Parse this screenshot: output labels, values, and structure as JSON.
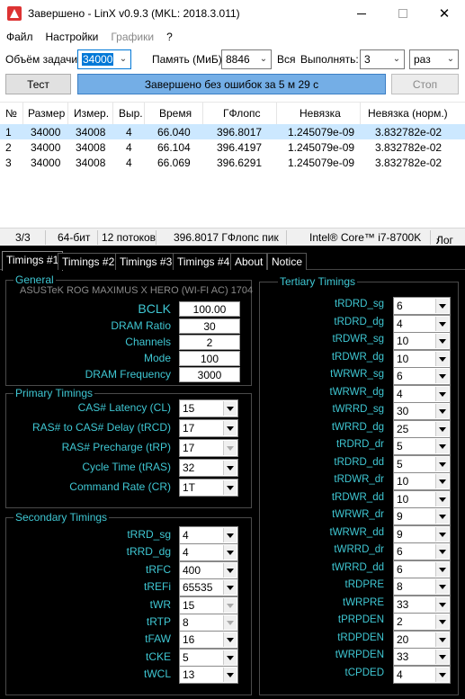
{
  "window": {
    "title": "Завершено - LinX v0.9.3 (MKL: 2018.3.011)",
    "minimize_icon": "minimize-icon",
    "maximize_icon": "maximize-icon",
    "close_icon": "close-icon",
    "close_glyph": "✕"
  },
  "menu": [
    "Файл",
    "Настройки",
    "Графики",
    "?"
  ],
  "controls": {
    "task_label": "Объём задачи:",
    "task_value": "34000",
    "memory_label": "Память (МиБ):",
    "memory_value": "8846",
    "all_label": "Вся",
    "run_label": "Выполнять:",
    "run_value": "3",
    "unit_value": "раз"
  },
  "buttons": {
    "test": "Тест",
    "progress_text": "Завершено без ошибок за 5 м 29 с",
    "progress_fraction": 1.0,
    "stop": "Стоп"
  },
  "results": {
    "headers": [
      "№",
      "Размер",
      "Измер.",
      "Выр.",
      "Время",
      "ГФлопс",
      "Невязка",
      "Невязка (норм.)"
    ],
    "rows": [
      [
        "1",
        "34000",
        "34008",
        "4",
        "66.040",
        "396.8017",
        "1.245079e-09",
        "3.832782e-02"
      ],
      [
        "2",
        "34000",
        "34008",
        "4",
        "66.104",
        "396.4197",
        "1.245079e-09",
        "3.832782e-02"
      ],
      [
        "3",
        "34000",
        "34008",
        "4",
        "66.069",
        "396.6291",
        "1.245079e-09",
        "3.832782e-02"
      ]
    ]
  },
  "status": {
    "progress": "3/3",
    "bits": "64-бит",
    "threads": "12 потоков",
    "peak": "396.8017 ГФлопс пик",
    "cpu": "Intel® Core™ i7-8700K",
    "log": "Лог",
    "log_arrow": "›"
  },
  "timing": {
    "tabs": [
      "Timings #1",
      "Timings #2",
      "Timings #3",
      "Timings #4",
      "About",
      "Notice"
    ],
    "general": {
      "title": "General",
      "motherboard": "ASUSTeK ROG MAXIMUS X HERO (WI-FI AC) 1704",
      "bclk_label": "BCLK",
      "bclk": "100.00",
      "ratio_label": "DRAM Ratio",
      "ratio": "30",
      "channels_label": "Channels",
      "channels": "2",
      "mode_label": "Mode",
      "mode": "100",
      "freq_label": "DRAM Frequency",
      "freq": "3000"
    },
    "primary": {
      "title": "Primary Timings",
      "items": [
        {
          "label": "CAS# Latency (CL)",
          "value": "15",
          "enabled": true
        },
        {
          "label": "RAS# to CAS# Delay (tRCD)",
          "value": "17",
          "enabled": true
        },
        {
          "label": "RAS# Precharge (tRP)",
          "value": "17",
          "enabled": false
        },
        {
          "label": "Cycle Time (tRAS)",
          "value": "32",
          "enabled": true
        },
        {
          "label": "Command Rate (CR)",
          "value": "1T",
          "enabled": true
        }
      ]
    },
    "secondary": {
      "title": "Secondary Timings",
      "items": [
        {
          "label": "tRRD_sg",
          "value": "4",
          "enabled": true
        },
        {
          "label": "tRRD_dg",
          "value": "4",
          "enabled": true
        },
        {
          "label": "tRFC",
          "value": "400",
          "enabled": true
        },
        {
          "label": "tREFi",
          "value": "65535",
          "enabled": true
        },
        {
          "label": "tWR",
          "value": "15",
          "enabled": false
        },
        {
          "label": "tRTP",
          "value": "8",
          "enabled": false
        },
        {
          "label": "tFAW",
          "value": "16",
          "enabled": true
        },
        {
          "label": "tCKE",
          "value": "5",
          "enabled": true
        },
        {
          "label": "tWCL",
          "value": "13",
          "enabled": true
        }
      ]
    },
    "tertiary": {
      "title": "Tertiary Timings",
      "items": [
        {
          "label": "tRDRD_sg",
          "value": "6"
        },
        {
          "label": "tRDRD_dg",
          "value": "4"
        },
        {
          "label": "tRDWR_sg",
          "value": "10"
        },
        {
          "label": "tRDWR_dg",
          "value": "10"
        },
        {
          "label": "tWRWR_sg",
          "value": "6"
        },
        {
          "label": "tWRWR_dg",
          "value": "4"
        },
        {
          "label": "tWRRD_sg",
          "value": "30"
        },
        {
          "label": "tWRRD_dg",
          "value": "25"
        },
        {
          "label": "tRDRD_dr",
          "value": "5"
        },
        {
          "label": "tRDRD_dd",
          "value": "5"
        },
        {
          "label": "tRDWR_dr",
          "value": "10"
        },
        {
          "label": "tRDWR_dd",
          "value": "10"
        },
        {
          "label": "tWRWR_dr",
          "value": "9"
        },
        {
          "label": "tWRWR_dd",
          "value": "9"
        },
        {
          "label": "tWRRD_dr",
          "value": "6"
        },
        {
          "label": "tWRRD_dd",
          "value": "6"
        },
        {
          "label": "tRDPRE",
          "value": "8"
        },
        {
          "label": "tWRPRE",
          "value": "33"
        },
        {
          "label": "tPRPDEN",
          "value": "2"
        },
        {
          "label": "tRDPDEN",
          "value": "20"
        },
        {
          "label": "tWRPDEN",
          "value": "33"
        },
        {
          "label": "tCPDED",
          "value": "4"
        }
      ]
    }
  }
}
